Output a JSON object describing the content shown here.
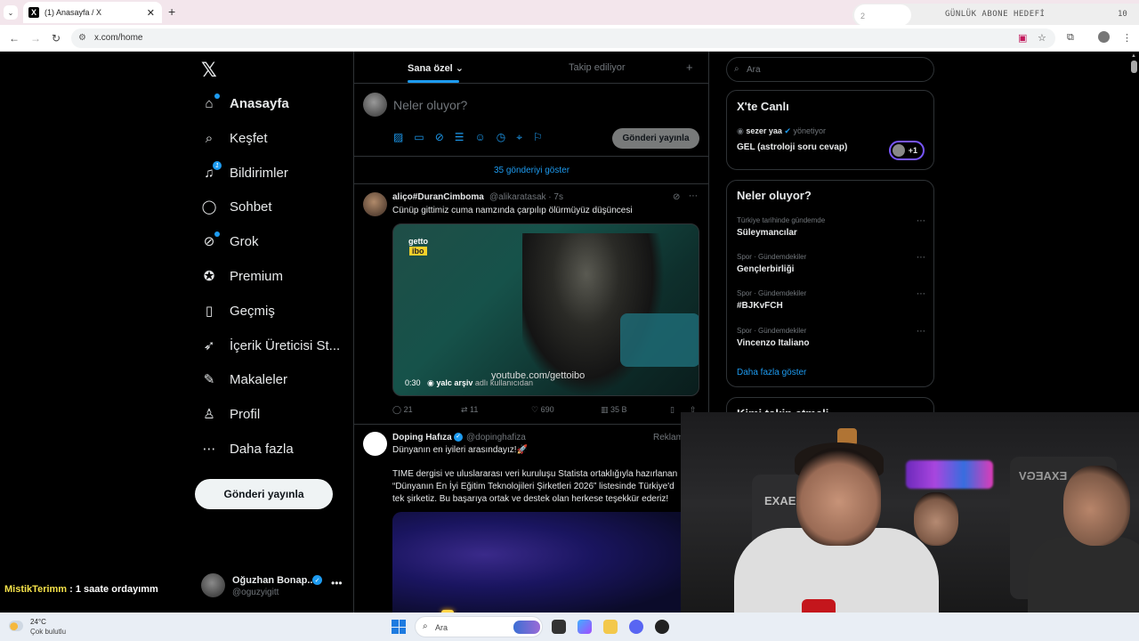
{
  "browser": {
    "tab_title": "(1) Anasayfa / X",
    "tab_close": "✕",
    "new_tab": "+",
    "url": "x.com/home",
    "overlay_small": "2",
    "overlay_label": "GÜNLÜK ABONE HEDEFİ",
    "overlay_value": "10"
  },
  "sidebar": {
    "items": [
      {
        "label": "Anasayfa",
        "icon": "home-icon",
        "glyph": "⌂"
      },
      {
        "label": "Keşfet",
        "icon": "search-icon",
        "glyph": "⌕"
      },
      {
        "label": "Bildirimler",
        "icon": "bell-icon",
        "glyph": "🔔︎",
        "badge": "1"
      },
      {
        "label": "Sohbet",
        "icon": "chat-icon",
        "glyph": "◯"
      },
      {
        "label": "Grok",
        "icon": "grok-icon",
        "glyph": "⊘"
      },
      {
        "label": "Premium",
        "icon": "premium-icon",
        "glyph": "✪"
      },
      {
        "label": "Geçmiş",
        "icon": "bookmark-icon",
        "glyph": "▯"
      },
      {
        "label": "İçerik Üreticisi St...",
        "icon": "rocket-icon",
        "glyph": "➶"
      },
      {
        "label": "Makaleler",
        "icon": "articles-icon",
        "glyph": "✎"
      },
      {
        "label": "Profil",
        "icon": "profile-icon",
        "glyph": "♙"
      },
      {
        "label": "Daha fazla",
        "icon": "more-icon",
        "glyph": "⋯"
      }
    ],
    "post_button": "Gönderi yayınla",
    "account": {
      "name": "Oğuzhan Bonap...",
      "handle": "@oguzyigitt"
    }
  },
  "stream_chat": {
    "user": "MistikTerimm",
    "message": " : 1 saate ordayımm"
  },
  "feed": {
    "tabs": {
      "for_you": "Sana özel",
      "following": "Takip ediliyor"
    },
    "compose": {
      "placeholder": "Neler oluyor?",
      "button": "Gönderi yayınla"
    },
    "show_posts": "35 gönderiyi göster",
    "tweets": [
      {
        "name": "aliço#DuranCimboma",
        "handle": "@alikaratasak · 7s",
        "text": "Cünüp gittimiz cuma namzında çarpılıp ölürmüyüz düşüncesi",
        "media": {
          "logo_top": "getto",
          "logo_bottom": "ibo",
          "watermark": "youtube.com/gettoibo",
          "duration": "0:30",
          "source_user": "yalc arşiv",
          "source_suffix": " adlı kullanıcıdan"
        },
        "stats": {
          "replies": "21",
          "retweets": "11",
          "likes": "690",
          "views": "35 B"
        }
      },
      {
        "name": "Doping Hafıza",
        "handle": "@dopinghafiza",
        "ad": "Reklam",
        "line1": "Dünyanın en iyileri arasındayız!🚀",
        "text": "TIME dergisi ve uluslararası veri kuruluşu Statista ortaklığıyla hazırlanan “Dünyanın En İyi Eğitim Teknolojileri Şirketleri 2026” listesinde Türkiye'd tek şirketiz. Bu başarıya ortak ve destek olan herkese teşekkür ederiz!"
      }
    ]
  },
  "right": {
    "search_placeholder": "Ara",
    "live": {
      "title": "X'te Canlı",
      "host": "sezer yaa",
      "host_suffix": " yönetiyor",
      "stream_title": "GEL (astroloji soru cevap)",
      "listeners": "+1"
    },
    "trends": {
      "title": "Neler oluyor?",
      "items": [
        {
          "category": "Türkiye tarihinde gündemde",
          "name": "Süleymancılar"
        },
        {
          "category": "Spor · Gündemdekiler",
          "name": "Gençlerbirliği"
        },
        {
          "category": "Spor · Gündemdekiler",
          "name": "#BJKvFCH"
        },
        {
          "category": "Spor · Gündemdekiler",
          "name": "Vincenzo Italiano"
        }
      ],
      "show_more": "Daha fazla göster"
    },
    "follow_title": "Kimi takip etmeli"
  },
  "webcam": {
    "chair_brand": "EXAEGV"
  },
  "taskbar": {
    "temperature": "24°C",
    "condition": "Çok bulutlu",
    "search": "Ara"
  },
  "colors": {
    "accent": "#1d9bf0",
    "background": "#000000",
    "border": "#2f3336",
    "muted": "#71767b",
    "live_ring": "#7856ff"
  }
}
